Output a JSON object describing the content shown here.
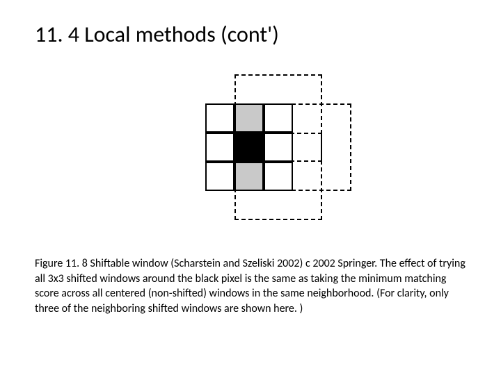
{
  "heading": "11. 4 Local methods (cont')",
  "caption": "Figure 11. 8 Shiftable window (Scharstein and Szeliski 2002) c 2002 Springer. The effect of trying all 3x3 shifted windows around the black pixel is the same as taking the minimum matching score across all centered (non-shifted) windows in the same neighborhood. (For clarity, only three of the neighboring shifted windows are shown here. )"
}
